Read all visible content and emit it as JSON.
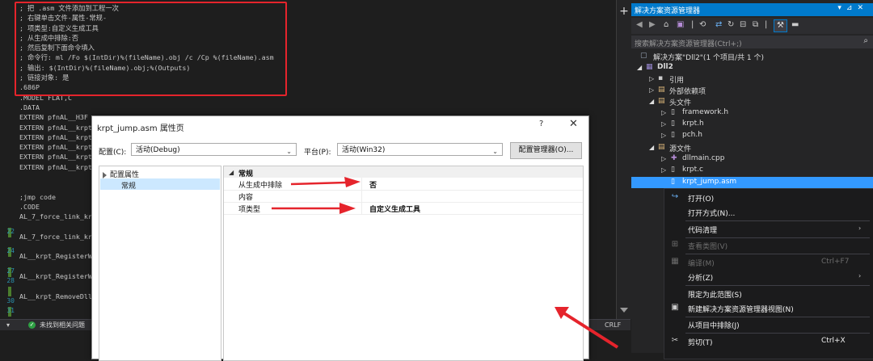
{
  "editor": {
    "code_lines": [
      "; 把 .asm 文件添加到工程一次",
      "; 右键单击文件-属性-常规-",
      "; 项类型:自定义生成工具",
      "; 从生成中排除:否",
      "; 然后复制下面命令填入",
      "; 命令行: ml /Fo $(IntDir)%(fileName).obj /c /Cp %(fileName).asm",
      "; 输出: $(IntDir)%(fileName).obj;%(Outputs)",
      "; 链接对象: 是",
      ".686P",
      ".MODEL FLAT,C",
      ".DATA",
      "EXTERN pfnAL__H3F",
      "EXTERN pfnAL__krpt",
      "EXTERN pfnAL__krpt",
      "EXTERN pfnAL__krpt",
      "EXTERN pfnAL__krpt",
      "EXTERN pfnAL__krpt",
      "",
      "",
      ";jmp code",
      ".CODE",
      "AL_7_force_link_kr",
      "",
      "AL_7_force_link_kr",
      "",
      "AL__krpt_RegisterW",
      "",
      "AL__krpt_RegisterW",
      "",
      "AL__krpt_RemoveDll"
    ],
    "line_numbers": [
      "22",
      "24",
      "27",
      "28",
      "30",
      "31"
    ]
  },
  "status_bar": {
    "message": "未找到相关问题",
    "row_label": "行",
    "line_ending": "CRLF"
  },
  "dialog": {
    "title": "krpt_jump.asm 属性页",
    "help": "?",
    "close": "✕",
    "config_label": "配置(C):",
    "config_value": "活动(Debug)",
    "platform_label": "平台(P):",
    "platform_value": "活动(Win32)",
    "config_manager_button": "配置管理器(O)...",
    "tree_root": "配置属性",
    "tree_child": "常规",
    "section_title": "常规",
    "properties": [
      {
        "name": "从生成中排除",
        "value": "否"
      },
      {
        "name": "内容",
        "value": ""
      },
      {
        "name": "项类型",
        "value": "自定义生成工具"
      }
    ]
  },
  "solution_explorer": {
    "title": "解决方案资源管理器",
    "search_placeholder": "搜索解决方案资源管理器(Ctrl+;)",
    "rows": [
      {
        "label": "解决方案\"Dll2\"(1 个项目/共 1 个)",
        "icon": "solution-icon"
      },
      {
        "label": "Dll2",
        "icon": "project-icon"
      },
      {
        "label": "引用",
        "icon": "references-icon"
      },
      {
        "label": "外部依赖项",
        "icon": "external-deps-icon"
      },
      {
        "label": "头文件",
        "icon": "folder-icon"
      },
      {
        "label": "framework.h",
        "icon": "header-file-icon"
      },
      {
        "label": "krpt.h",
        "icon": "header-file-icon"
      },
      {
        "label": "pch.h",
        "icon": "header-file-icon"
      },
      {
        "label": "源文件",
        "icon": "folder-icon"
      },
      {
        "label": "dllmain.cpp",
        "icon": "cpp-file-icon"
      },
      {
        "label": "krpt.c",
        "icon": "c-file-icon"
      },
      {
        "label": "krpt_jump.asm",
        "icon": "asm-file-icon"
      }
    ]
  },
  "context_menu": {
    "items": [
      {
        "label": "打开(O)",
        "shortcut": "",
        "submenu": false,
        "disabled": false,
        "icon": "open-icon"
      },
      {
        "label": "打开方式(N)...",
        "shortcut": "",
        "submenu": false,
        "disabled": false,
        "icon": ""
      },
      {
        "label": "代码清理",
        "shortcut": "",
        "submenu": true,
        "disabled": false,
        "icon": ""
      },
      {
        "label": "查看类图(V)",
        "shortcut": "",
        "submenu": false,
        "disabled": true,
        "icon": "class-diagram-icon"
      },
      {
        "label": "编译(M)",
        "shortcut": "Ctrl+F7",
        "submenu": false,
        "disabled": true,
        "icon": "compile-icon"
      },
      {
        "label": "分析(Z)",
        "shortcut": "",
        "submenu": true,
        "disabled": false,
        "icon": ""
      },
      {
        "label": "限定为此范围(S)",
        "shortcut": "",
        "submenu": false,
        "disabled": false,
        "icon": ""
      },
      {
        "label": "新建解决方案资源管理器视图(N)",
        "shortcut": "",
        "submenu": false,
        "disabled": false,
        "icon": "new-view-icon"
      },
      {
        "label": "从项目中排除(J)",
        "shortcut": "",
        "submenu": false,
        "disabled": false,
        "icon": ""
      },
      {
        "label": "剪切(T)",
        "shortcut": "Ctrl+X",
        "submenu": false,
        "disabled": false,
        "icon": "cut-icon"
      }
    ]
  },
  "colors": {
    "accent": "#007acc",
    "annotation_red": "#e5242c",
    "selection": "#3399ff"
  }
}
